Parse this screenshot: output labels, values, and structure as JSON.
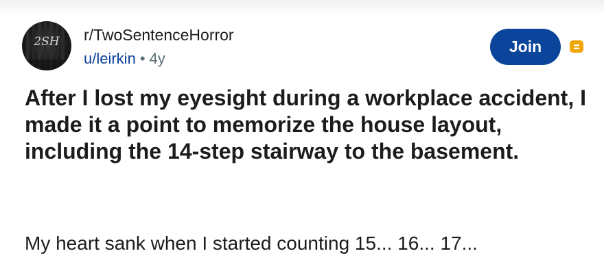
{
  "post": {
    "avatar_text": "2SH",
    "subreddit": "r/TwoSentenceHorror",
    "username": "u/leirkin",
    "separator": "•",
    "age": "4y",
    "join_label": "Join",
    "title": "After I lost my eyesight during a workplace accident, I made it a point to memorize the house layout, including the 14-step stairway to the basement.",
    "body": "My heart sank when I started counting 15... 16... 17..."
  },
  "colors": {
    "join_button": "#0a449b",
    "username": "#0b3e9c",
    "inbox_icon": "#f0a500"
  },
  "icons": {
    "inbox": "archive-box-icon"
  }
}
